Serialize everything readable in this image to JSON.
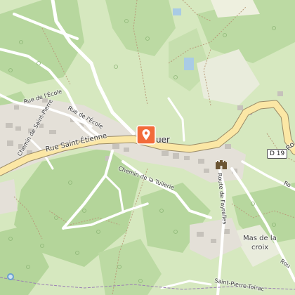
{
  "map": {
    "place_name_partial": "uer",
    "route_shield": "D 19",
    "labels": {
      "rue_ecole_1": "Rue de l'École",
      "rue_ecole_2": "Rue de l'École",
      "chemin_saint_pierre": "Chemin de Saint-Pierre",
      "rue_saint_etienne": "Rue Saint-Étienne",
      "chemin_tuilerie": "Chemin de la Tuilerie",
      "route_fayrelles": "Route de Fayrelles",
      "mas_de_la_croix_1": "Mas de la",
      "mas_de_la_croix_2": "croix",
      "saint_pierre_toirac": "Saint-Pierre-Toirac",
      "ro_top_right": "Ro",
      "ro_right": "Ro",
      "ro_bottom_right": "Rou"
    },
    "icons": {
      "pin": "location-pin-icon",
      "castle": "castle-icon",
      "poi": "water-point-icon"
    },
    "colors": {
      "meadow": "#d8e9c0",
      "forest": "#b9d9a0",
      "built": "#e6e2dc",
      "building": "#c9c5bf",
      "road_major": "#fde9a8",
      "road_minor": "#ffffff",
      "pin": "#f26b3a"
    }
  }
}
